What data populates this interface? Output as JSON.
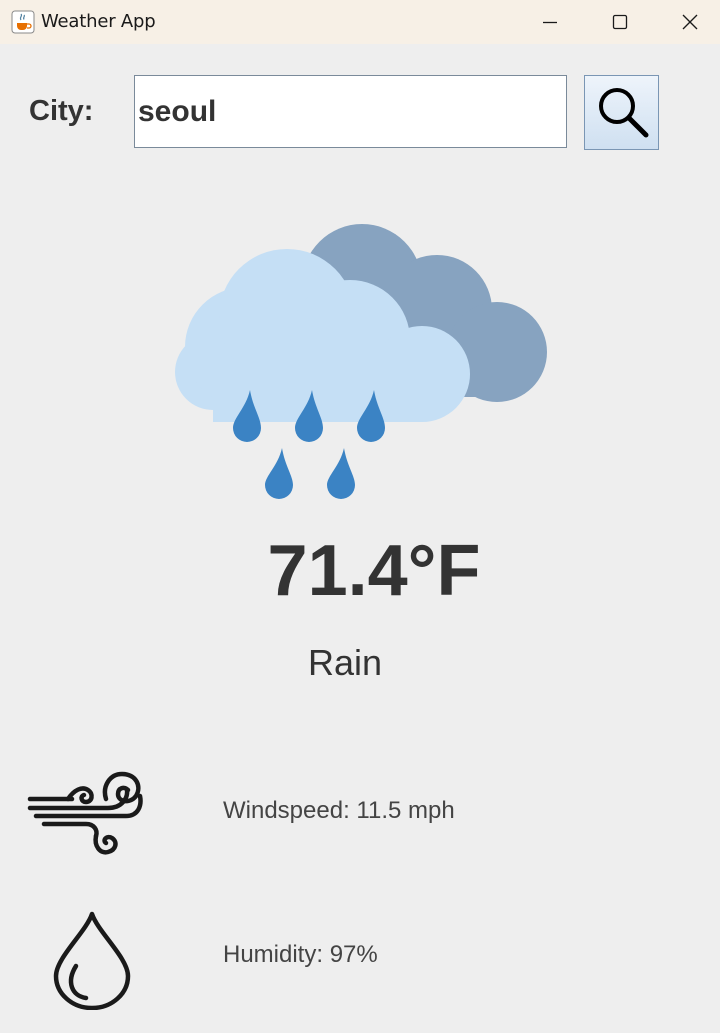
{
  "window": {
    "title": "Weather App",
    "icon": "java-cup-icon",
    "controls": [
      "minimize-icon",
      "maximize-icon",
      "close-icon"
    ]
  },
  "search": {
    "label": "City:",
    "value": "seoul",
    "button_icon": "search-icon"
  },
  "weather": {
    "icon": "rain-cloud-icon",
    "temperature": "71.4°F",
    "condition": "Rain"
  },
  "details": {
    "windspeed_icon": "wind-icon",
    "windspeed": "Windspeed: 11.5 mph",
    "humidity_icon": "water-drop-icon",
    "humidity": "Humidity: 97%"
  },
  "colors": {
    "background": "#eeeeee",
    "titlebar": "#f7f0e6",
    "text": "#333333",
    "cloud_front": "#c5dff5",
    "cloud_back": "#87a3c0",
    "rain_drop": "#3b83c4"
  }
}
